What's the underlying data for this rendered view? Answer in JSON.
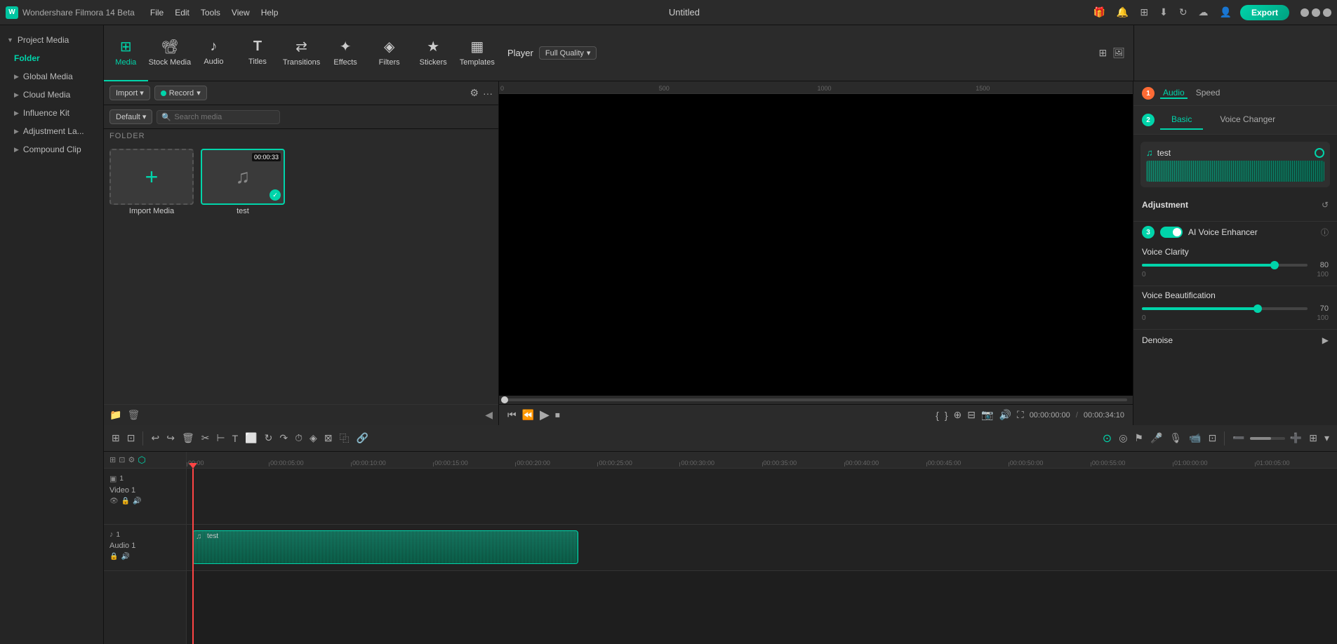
{
  "app": {
    "name": "Wondershare Filmora 14 Beta",
    "title": "Untitled",
    "logo": "W"
  },
  "menu": {
    "items": [
      "File",
      "Edit",
      "Tools",
      "View",
      "Help"
    ]
  },
  "titlebar": {
    "window_title": "Untitled",
    "export_label": "Export"
  },
  "toolbar": {
    "items": [
      {
        "id": "media",
        "label": "Media",
        "icon": "⊞",
        "active": true
      },
      {
        "id": "stock",
        "label": "Stock Media",
        "icon": "🎬"
      },
      {
        "id": "audio",
        "label": "Audio",
        "icon": "♪"
      },
      {
        "id": "titles",
        "label": "Titles",
        "icon": "T"
      },
      {
        "id": "transitions",
        "label": "Transitions",
        "icon": "⇄"
      },
      {
        "id": "effects",
        "label": "Effects",
        "icon": "✦"
      },
      {
        "id": "filters",
        "label": "Filters",
        "icon": "◈"
      },
      {
        "id": "stickers",
        "label": "Stickers",
        "icon": "★"
      },
      {
        "id": "templates",
        "label": "Templates",
        "icon": "▦"
      }
    ]
  },
  "sidebar": {
    "items": [
      {
        "label": "Project Media",
        "expanded": true
      },
      {
        "label": "Folder",
        "active": true
      },
      {
        "label": "Global Media"
      },
      {
        "label": "Cloud Media"
      },
      {
        "label": "Influence Kit"
      },
      {
        "label": "Adjustment La..."
      },
      {
        "label": "Compound Clip"
      }
    ]
  },
  "media_panel": {
    "import_label": "Import",
    "record_label": "Record",
    "default_label": "Default",
    "search_placeholder": "Search media",
    "folder_label": "FOLDER",
    "files": [
      {
        "name": "Import Media",
        "type": "add"
      },
      {
        "name": "test",
        "type": "audio",
        "duration": "00:00:33",
        "selected": true
      }
    ]
  },
  "player": {
    "title": "Player",
    "quality": "Full Quality",
    "current_time": "00:00:00:00",
    "total_time": "00:00:34:10",
    "time_separator": "/",
    "progress": 0
  },
  "right_panel": {
    "tabs": [
      {
        "label": "Audio",
        "active": true
      },
      {
        "label": "Speed"
      }
    ],
    "sub_tabs": [
      {
        "label": "Basic",
        "active": true
      },
      {
        "label": "Voice Changer"
      }
    ],
    "audio_track": {
      "name": "test",
      "icon": "♫"
    },
    "adjustment": {
      "title": "Adjustment"
    },
    "ai_enhancer": {
      "label": "AI Voice Enhancer",
      "enabled": true
    },
    "voice_clarity": {
      "label": "Voice Clarity",
      "value": 80,
      "min": 0,
      "max": 100,
      "percent": 80
    },
    "voice_beautification": {
      "label": "Voice Beautification",
      "value": 70,
      "min": 0,
      "max": 100,
      "percent": 70
    },
    "denoise": {
      "label": "Denoise"
    }
  },
  "timeline": {
    "ruler_marks": [
      "00:00",
      "00:00:05:00",
      "00:00:10:00",
      "00:00:15:00",
      "00:00:20:00",
      "00:00:25:00",
      "00:00:30:00",
      "00:00:35:00",
      "00:00:40:00",
      "00:00:45:00",
      "00:00:50:00",
      "00:00:55:00",
      "01:00:00:00",
      "01:00:05:00"
    ],
    "tracks": [
      {
        "label": "Video 1",
        "type": "video",
        "icon": "▣"
      },
      {
        "label": "Audio 1",
        "type": "audio",
        "icon": "♪"
      }
    ],
    "audio_clip": {
      "name": "test",
      "width_pct": 36
    }
  }
}
